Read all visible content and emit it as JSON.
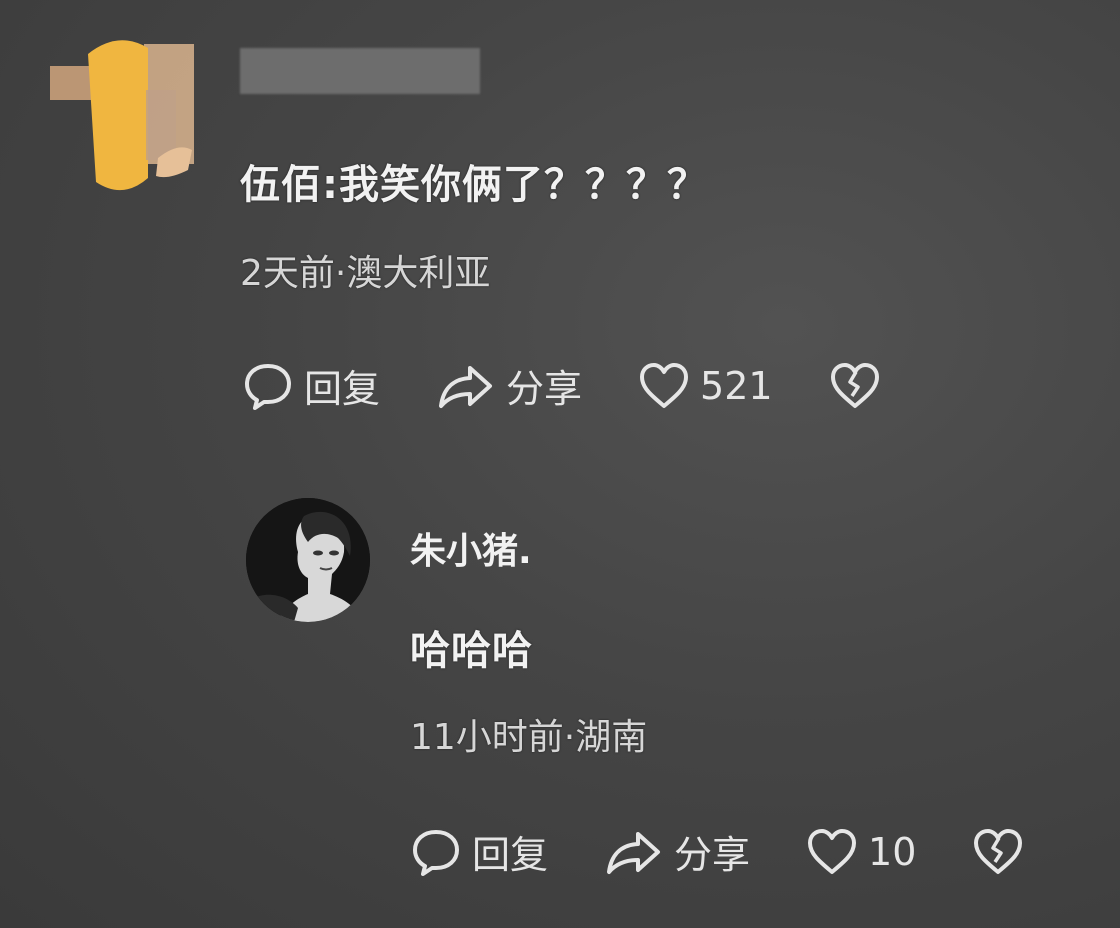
{
  "comment": {
    "text": "伍佰:我笑你俩了？？？？",
    "meta": "2天前·澳大利亚",
    "actions": {
      "reply_label": "回复",
      "share_label": "分享",
      "like_count": "521"
    }
  },
  "reply": {
    "author": "朱小猪.",
    "text": "哈哈哈",
    "meta": "11小时前·湖南",
    "actions": {
      "reply_label": "回复",
      "share_label": "分享",
      "like_count": "10"
    }
  },
  "icons": {
    "reply": "comment-bubble-icon",
    "share": "share-arrow-icon",
    "like": "heart-icon",
    "dislike": "broken-heart-icon"
  },
  "colors": {
    "background": "#454545",
    "text": "#f2f2f2",
    "avatar_accent": "#f0b640"
  }
}
